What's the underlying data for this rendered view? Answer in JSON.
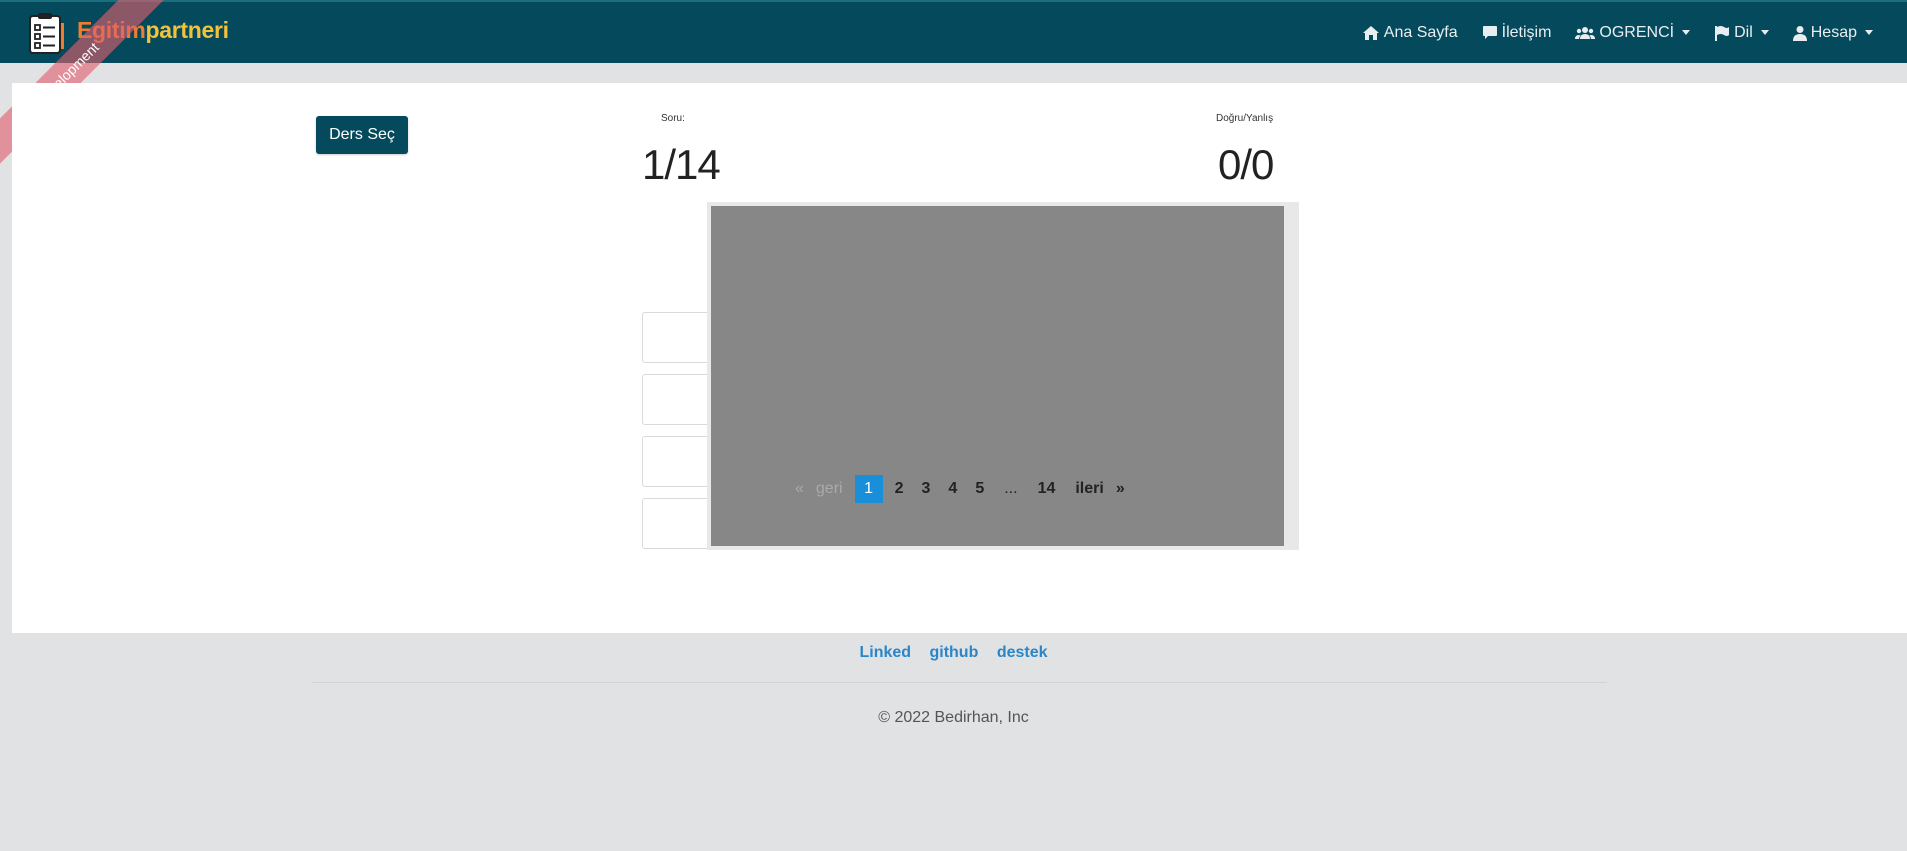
{
  "navbar": {
    "brand_part1": "Egitim",
    "brand_part2": "partneri",
    "items": [
      {
        "label": "Ana Sayfa",
        "icon": "home-icon"
      },
      {
        "label": "İletişim",
        "icon": "comment-icon"
      },
      {
        "label": "OGRENCİ",
        "icon": "users-icon",
        "dropdown": true
      },
      {
        "label": "Dil",
        "icon": "flag-icon",
        "dropdown": true
      },
      {
        "label": "Hesap",
        "icon": "user-icon",
        "dropdown": true
      }
    ]
  },
  "ribbon": "Development",
  "main": {
    "ders_sec": "Ders Seç",
    "soru_label": "Soru:",
    "soru_value": "1/14",
    "dogru_label": "Doğru/Yanlış",
    "dogru_value": "0/0"
  },
  "pagination": {
    "first": "«",
    "prev": "geri",
    "pages": [
      "1",
      "2",
      "3",
      "4",
      "5",
      "...",
      "14"
    ],
    "active": "1",
    "next": "ileri",
    "last": "»"
  },
  "footer": {
    "links": [
      "Linked",
      "github",
      "destek"
    ],
    "copyright": "© 2022 Bedirhan, Inc"
  },
  "colors": {
    "navbar": "#054a5c",
    "brand_orange": "#ef7d2c",
    "brand_yellow": "#f2c23a",
    "active_page": "#1a8fd9",
    "link": "#2a86c8"
  }
}
